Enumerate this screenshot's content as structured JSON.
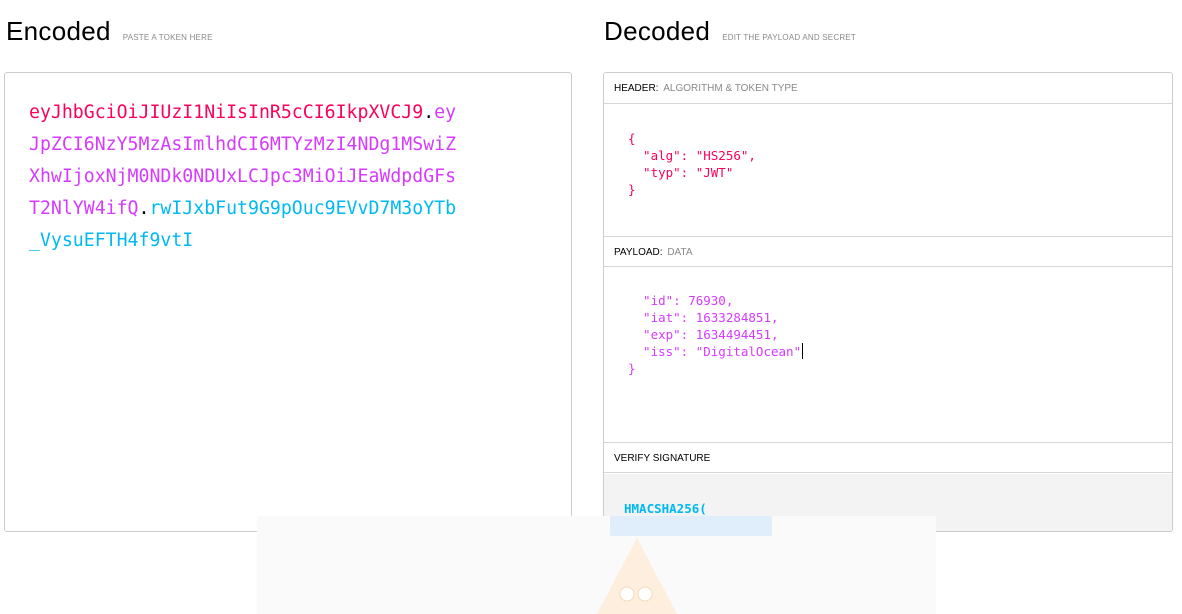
{
  "encoded": {
    "title": "Encoded",
    "hint": "PASTE A TOKEN HERE",
    "token_lines": [
      [
        {
          "text": "eyJhbGciOiJIUzI1NiIsInR5cCI6IkpXVCJ9",
          "part": "header"
        },
        {
          "text": ".",
          "part": "dot"
        },
        {
          "text": "ey",
          "part": "payload"
        }
      ],
      [
        {
          "text": "JpZCI6NzY5MzAsImlhdCI6MTYzMzI4NDg1MSwiZ",
          "part": "payload"
        }
      ],
      [
        {
          "text": "XhwIjoxNjM0NDk0NDUxLCJpc3MiOiJEaWdpdGFs",
          "part": "payload"
        }
      ],
      [
        {
          "text": "T2NlYW4ifQ",
          "part": "payload"
        },
        {
          "text": ".",
          "part": "dot"
        },
        {
          "text": "rwIJxbFut9G9pOuc9EVvD7M3oYTb",
          "part": "sig"
        }
      ],
      [
        {
          "text": "_VysuEFTH4f9vtI",
          "part": "sig"
        }
      ]
    ]
  },
  "decoded": {
    "title": "Decoded",
    "hint": "EDIT THE PAYLOAD AND SECRET",
    "header_section": {
      "title": "HEADER:",
      "subtitle": "ALGORITHM & TOKEN TYPE",
      "code_lines": [
        "{",
        "  \"alg\": \"HS256\",",
        "  \"typ\": \"JWT\"",
        "}"
      ]
    },
    "payload_section": {
      "title": "PAYLOAD:",
      "subtitle": "DATA",
      "code_lines": [
        "  \"id\": 76930,",
        "  \"iat\": 1633284851,",
        "  \"exp\": 1634494451,",
        "  \"iss\": \"DigitalOcean\"",
        "}"
      ]
    },
    "signature_section": {
      "title": "VERIFY SIGNATURE",
      "code_first_line": "HMACSHA256("
    }
  },
  "colors": {
    "header": "#fb015b",
    "payload": "#d63aff",
    "signature": "#00b9f1"
  }
}
